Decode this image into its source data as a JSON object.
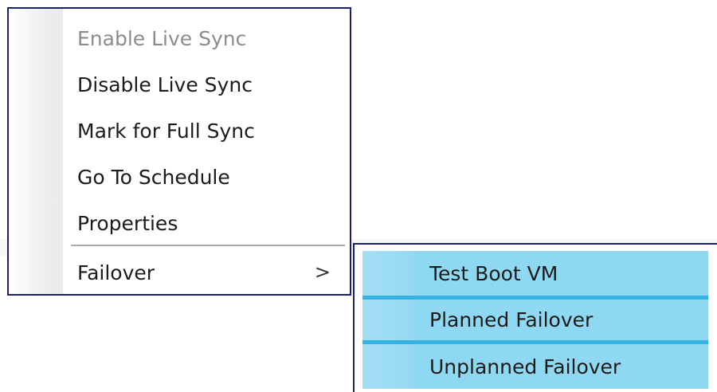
{
  "context_menu": {
    "items": [
      {
        "label": "Enable Live Sync",
        "enabled": false
      },
      {
        "label": "Disable Live Sync",
        "enabled": true
      },
      {
        "label": "Mark for Full Sync",
        "enabled": true
      },
      {
        "label": "Go To Schedule",
        "enabled": true
      },
      {
        "label": "Properties",
        "enabled": true
      },
      {
        "label": "Failover",
        "enabled": true,
        "has_submenu": true,
        "submenu_glyph": ">"
      }
    ]
  },
  "failover_submenu": {
    "items": [
      {
        "label": "Test Boot VM"
      },
      {
        "label": "Planned Failover"
      },
      {
        "label": "Unplanned Failover"
      }
    ],
    "highlight_color": "#8fd8f1",
    "divider_color": "#34b2e4"
  },
  "colors": {
    "menu_border": "#1a1f6e",
    "text": "#1b1b1b",
    "disabled_text": "#8c8c8c"
  }
}
